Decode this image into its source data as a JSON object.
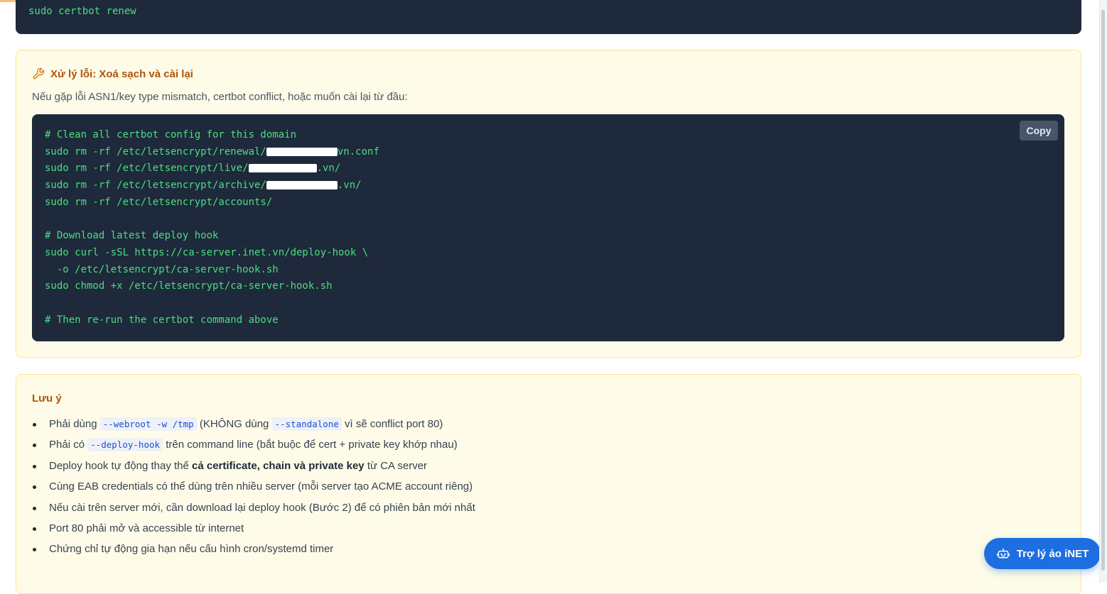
{
  "previous_code": {
    "line": "sudo certbot renew"
  },
  "fix_section": {
    "title": "Xử lý lỗi: Xoá sạch và cài lại",
    "description": "Nếu gặp lỗi ASN1/key type mismatch, certbot conflict, hoặc muốn cài lại từ đầu:",
    "copy_label": "Copy",
    "code": {
      "comment1": "# Clean all certbot config for this domain",
      "rm_renewal_prefix": "sudo rm -rf /etc/letsencrypt/renewal/",
      "rm_renewal_suffix": "vn.conf",
      "rm_live_prefix": "sudo rm -rf /etc/letsencrypt/live/",
      "rm_live_suffix": ".vn/",
      "rm_archive_prefix": "sudo rm -rf /etc/letsencrypt/archive/",
      "rm_archive_suffix": ".vn/",
      "rm_accounts": "sudo rm -rf /etc/letsencrypt/accounts/",
      "comment2": "# Download latest deploy hook",
      "curl_line": "sudo curl -sSL https://ca-server.inet.vn/deploy-hook \\",
      "curl_output": "  -o /etc/letsencrypt/ca-server-hook.sh",
      "chmod_line": "sudo chmod +x /etc/letsencrypt/ca-server-hook.sh",
      "comment3": "# Then re-run the certbot command above"
    }
  },
  "note_section": {
    "title": "Lưu ý",
    "items": [
      {
        "before": "Phải dùng ",
        "code": "--webroot -w /tmp",
        "middle": " (KHÔNG dùng ",
        "code2": "--standalone",
        "after": " vì sẽ conflict port 80)"
      },
      {
        "before": "Phải có ",
        "code": "--deploy-hook",
        "after": " trên command line (bắt buộc để cert + private key khớp nhau)"
      },
      {
        "before": "Deploy hook tự động thay thế ",
        "bold": "cả certificate, chain và private key",
        "after": " từ CA server"
      },
      {
        "text": "Cùng EAB credentials có thể dùng trên nhiều server (mỗi server tạo ACME account riêng)"
      },
      {
        "text": "Nếu cài trên server mới, cần download lại deploy hook (Bước 2) để có phiên bản mới nhất"
      },
      {
        "text": "Port 80 phải mở và accessible từ internet"
      },
      {
        "text": "Chứng chỉ tự động gia hạn nếu cấu hình cron/systemd timer"
      }
    ]
  },
  "assistant": {
    "label": "Trợ lý ảo iNET",
    "icon": "robot-icon",
    "color": "#1d6ee0"
  },
  "colors": {
    "code_bg": "#1e293b",
    "code_text": "#4ade80",
    "card_bg": "#fefce8",
    "card_border": "#fde68a",
    "title_color": "#b45309"
  }
}
